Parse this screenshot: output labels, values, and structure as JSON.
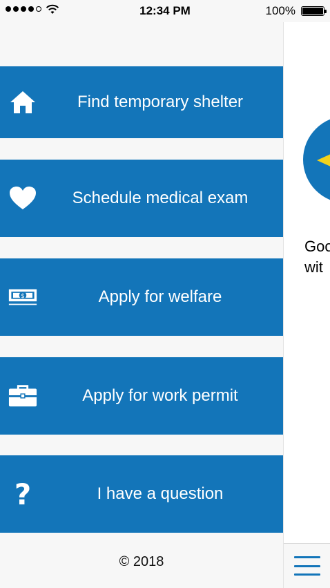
{
  "status_bar": {
    "time": "12:34 PM",
    "battery": "100%",
    "signal_bars": 4,
    "signal_total": 5
  },
  "menu": {
    "items": [
      {
        "label": "Find temporary shelter",
        "icon": "home-icon"
      },
      {
        "label": "Schedule medical exam",
        "icon": "heart-icon"
      },
      {
        "label": "Apply for welfare",
        "icon": "money-icon"
      },
      {
        "label": "Apply for work permit",
        "icon": "briefcase-icon"
      },
      {
        "label": "I have a question",
        "icon": "question-icon"
      }
    ],
    "copyright": "© 2018"
  },
  "main_peek": {
    "text_line_1": "Goo",
    "text_line_2": "wit"
  },
  "colors": {
    "accent": "#1375b9",
    "highlight": "#f2d21b",
    "background": "#f7f7f7"
  }
}
